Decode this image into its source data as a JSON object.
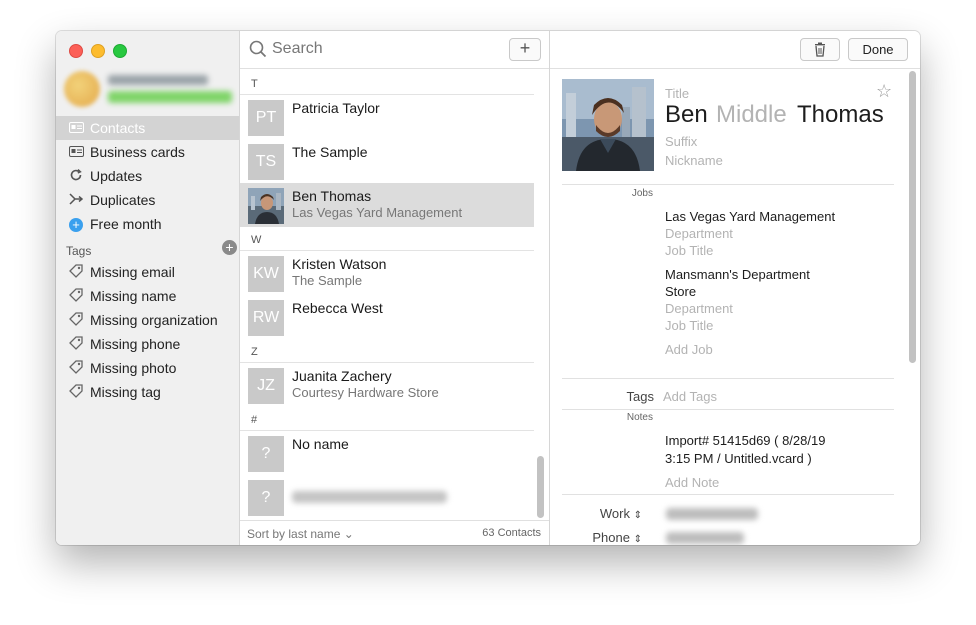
{
  "sidebar": {
    "items": [
      {
        "label": "Contacts",
        "icon": "contacts-card-icon",
        "selected": true
      },
      {
        "label": "Business cards",
        "icon": "business-card-icon"
      },
      {
        "label": "Updates",
        "icon": "refresh-icon"
      },
      {
        "label": "Duplicates",
        "icon": "merge-icon"
      },
      {
        "label": "Free month",
        "icon": "plus-circle-icon"
      }
    ],
    "tags_heading": "Tags",
    "tags": [
      {
        "label": "Missing email",
        "icon": "tag-icon"
      },
      {
        "label": "Missing name",
        "icon": "tag-icon"
      },
      {
        "label": "Missing organization",
        "icon": "tag-icon"
      },
      {
        "label": "Missing phone",
        "icon": "tag-icon"
      },
      {
        "label": "Missing photo",
        "icon": "tag-icon"
      },
      {
        "label": "Missing tag",
        "icon": "tag-icon"
      }
    ]
  },
  "list": {
    "search_placeholder": "Search",
    "sections": [
      {
        "letter": "T"
      },
      {
        "letter": "W"
      },
      {
        "letter": "Z"
      },
      {
        "letter": "#"
      }
    ],
    "contacts": [
      {
        "initials": "PT",
        "name": "Patricia Taylor",
        "sub": ""
      },
      {
        "initials": "TS",
        "name": "The Sample",
        "sub": ""
      },
      {
        "initials": "",
        "name": "Ben Thomas",
        "sub": "Las Vegas Yard Management",
        "selected": true
      },
      {
        "initials": "KW",
        "name": "Kristen Watson",
        "sub": "The Sample"
      },
      {
        "initials": "RW",
        "name": "Rebecca West",
        "sub": ""
      },
      {
        "initials": "JZ",
        "name": "Juanita Zachery",
        "sub": "Courtesy Hardware Store"
      },
      {
        "initials": "?",
        "name": "No name",
        "sub": ""
      },
      {
        "initials": "?",
        "name": "",
        "sub": ""
      }
    ],
    "sort_label": "Sort by last name",
    "count": "63 Contacts"
  },
  "detail": {
    "done_label": "Done",
    "title_placeholder": "Title",
    "first_name": "Ben",
    "middle_placeholder": "Middle",
    "last_name": "Thomas",
    "suffix_placeholder": "Suffix",
    "nickname_placeholder": "Nickname",
    "jobs_label": "Jobs",
    "job1_company": "Las Vegas Yard Management",
    "job1_department": "Department",
    "job1_title": "Job Title",
    "job2_company_line1": "Mansmann's Department",
    "job2_company_line2": "Store",
    "job2_department": "Department",
    "job2_title": "Job Title",
    "add_job": "Add Job",
    "tags_label": "Tags",
    "add_tags": "Add Tags",
    "notes_label": "Notes",
    "note_line1": "Import#  51415d69  ( 8/28/19",
    "note_line2": "3:15 PM / Untitled.vcard )",
    "add_note": "Add Note",
    "work_label": "Work",
    "phone_label": "Phone"
  }
}
